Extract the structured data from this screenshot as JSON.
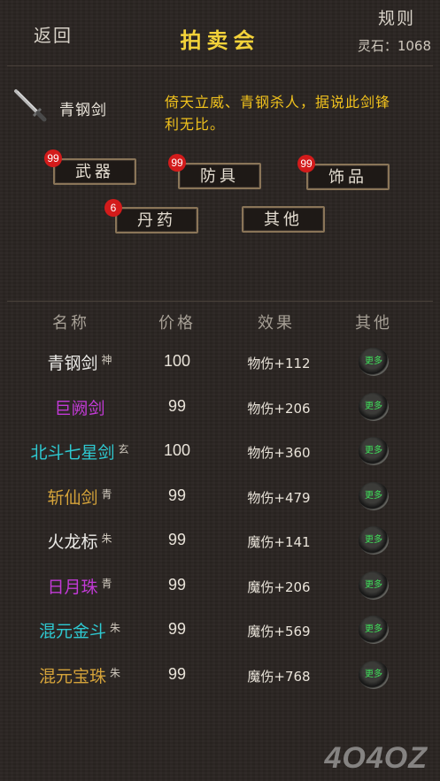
{
  "header": {
    "back_label": "返回",
    "title": "拍卖会",
    "rules_label": "规则",
    "stone_label": "灵石：1068"
  },
  "selected_item": {
    "icon": "sword-icon",
    "name": "青钢剑",
    "description": "倚天立威、青钢杀人，据说此剑锋利无比。"
  },
  "categories": [
    {
      "label": "武器",
      "badge": "99"
    },
    {
      "label": "防具",
      "badge": "99"
    },
    {
      "label": "饰品",
      "badge": "99"
    },
    {
      "label": "丹药",
      "badge": "6"
    },
    {
      "label": "其他",
      "badge": ""
    }
  ],
  "table": {
    "headers": [
      "名称",
      "价格",
      "效果",
      "其他"
    ],
    "rows": [
      {
        "name": "青钢剑",
        "tag": "神",
        "price": "100",
        "effect": "物伤+112",
        "color": "#ecebe8",
        "more": "更多"
      },
      {
        "name": "巨阙剑",
        "tag": "",
        "price": "99",
        "effect": "物伤+206",
        "color": "#c23ad6",
        "more": "更多"
      },
      {
        "name": "北斗七星剑",
        "tag": "玄",
        "price": "100",
        "effect": "物伤+360",
        "color": "#2ec9d1",
        "more": "更多"
      },
      {
        "name": "斩仙剑",
        "tag": "青",
        "price": "99",
        "effect": "物伤+479",
        "color": "#d5a33a",
        "more": "更多"
      },
      {
        "name": "火龙标",
        "tag": "朱",
        "price": "99",
        "effect": "魔伤+141",
        "color": "#ecebe8",
        "more": "更多"
      },
      {
        "name": "日月珠",
        "tag": "青",
        "price": "99",
        "effect": "魔伤+206",
        "color": "#c23ad6",
        "more": "更多"
      },
      {
        "name": "混元金斗",
        "tag": "朱",
        "price": "99",
        "effect": "魔伤+569",
        "color": "#2ec9d1",
        "more": "更多"
      },
      {
        "name": "混元宝珠",
        "tag": "朱",
        "price": "99",
        "effect": "魔伤+768",
        "color": "#d5a33a",
        "more": "更多"
      }
    ]
  },
  "watermark": "4O4OZ"
}
